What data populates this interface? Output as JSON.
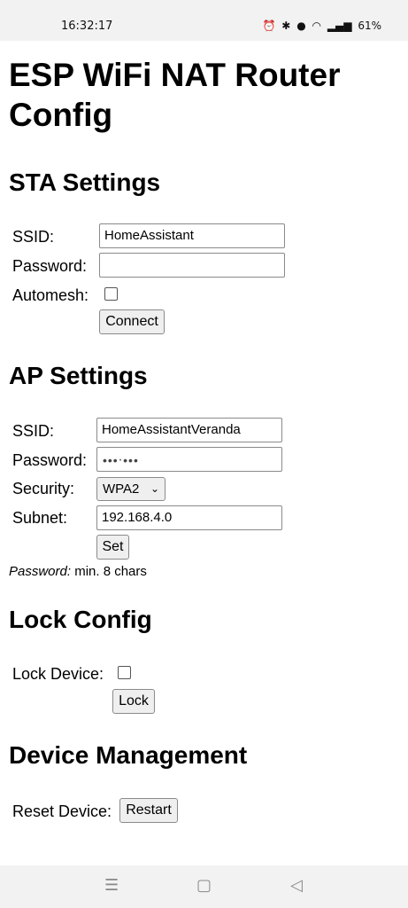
{
  "status_bar": {
    "time": "16:32:17",
    "battery": "61%"
  },
  "page_title": "ESP WiFi NAT Router Config",
  "sta": {
    "heading": "STA Settings",
    "ssid_label": "SSID:",
    "ssid_value": "HomeAssistant",
    "password_label": "Password:",
    "password_value": "",
    "automesh_label": "Automesh:",
    "connect_label": "Connect"
  },
  "ap": {
    "heading": "AP Settings",
    "ssid_label": "SSID:",
    "ssid_value": "HomeAssistantVeranda",
    "password_label": "Password:",
    "security_label": "Security:",
    "security_value": "WPA2",
    "subnet_label": "Subnet:",
    "subnet_value": "192.168.4.0",
    "set_label": "Set",
    "note_label": "Password:",
    "note_text": " min. 8 chars"
  },
  "lock": {
    "heading": "Lock Config",
    "lock_device_label": "Lock Device:",
    "lock_button": "Lock"
  },
  "device": {
    "heading": "Device Management",
    "reset_label": "Reset Device:",
    "restart_button": "Restart"
  }
}
